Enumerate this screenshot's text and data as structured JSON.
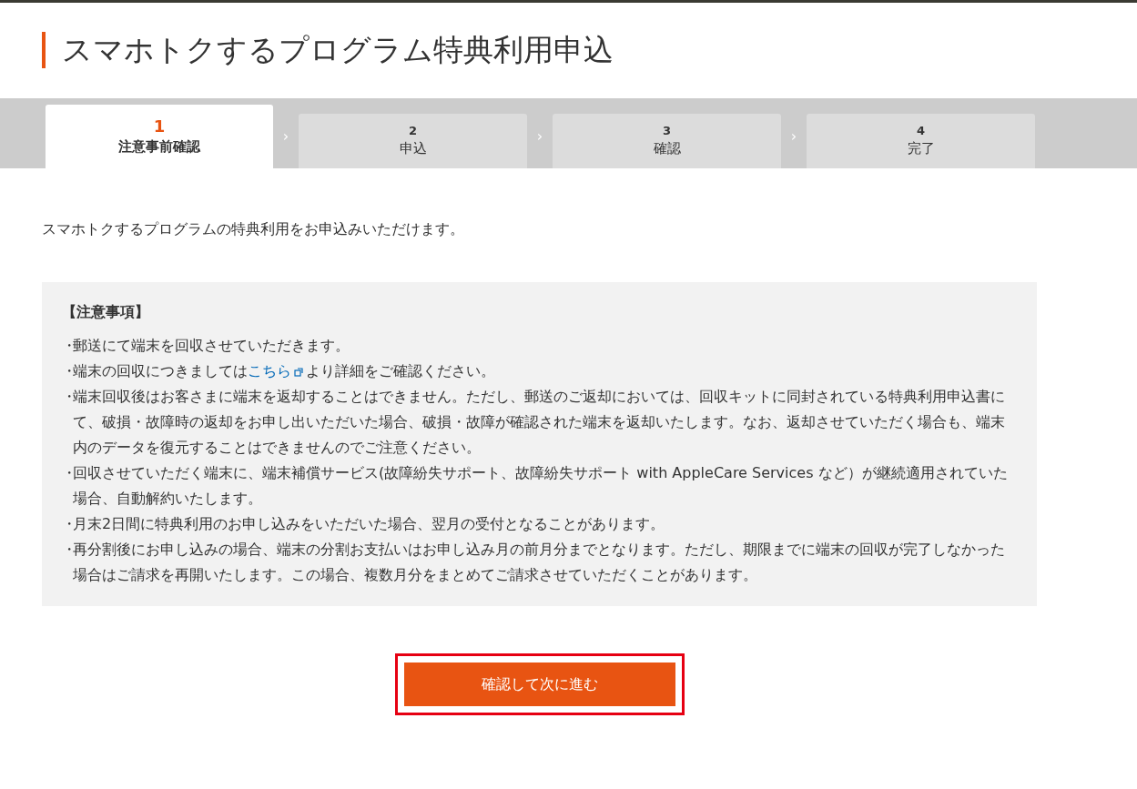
{
  "title": "スマホトクするプログラム特典利用申込",
  "steps": [
    {
      "number": "1",
      "label": "注意事前確認",
      "selected": true
    },
    {
      "number": "2",
      "label": "申込",
      "selected": false
    },
    {
      "number": "3",
      "label": "確認",
      "selected": false
    },
    {
      "number": "4",
      "label": "完了",
      "selected": false
    }
  ],
  "step_separator": "›",
  "intro": "スマホトクするプログラムの特典利用をお申込みいただけます。",
  "notes": {
    "heading": "【注意事項】",
    "items": [
      {
        "bullet": "・",
        "text": "郵送にて端末を回収させていただきます。"
      },
      {
        "bullet": "・",
        "text": "端末の回収につきましては",
        "link": "こちら",
        "text_after": "より詳細をご確認ください。"
      },
      {
        "bullet": "・",
        "text": "端末回収後はお客さまに端末を返却することはできません。ただし、郵送のご返却においては、回収キットに同封されている特典利用申込書にて、破損・故障時の返却をお申し出いただいた場合、破損・故障が確認された端末を返却いたします。なお、返却させていただく場合も、端末内のデータを復元することはできませんのでご注意ください。"
      },
      {
        "bullet": "・",
        "text": "回収させていただく端末に、端末補償サービス(故障紛失サポート、故障紛失サポート with AppleCare Services など）が継続適用されていた場合、自動解約いたします。"
      },
      {
        "bullet": "・",
        "text": "月末2日間に特典利用のお申し込みをいただいた場合、翌月の受付となることがあります。"
      },
      {
        "bullet": "・",
        "text": "再分割後にお申し込みの場合、端末の分割お支払いはお申し込み月の前月分までとなります。ただし、期限までに端末の回収が完了しなかった場合はご請求を再開いたします。この場合、複数月分をまとめてご請求させていただくことがあります。"
      }
    ]
  },
  "next_button": {
    "label": "確認して次に進む",
    "highlighted": true
  }
}
